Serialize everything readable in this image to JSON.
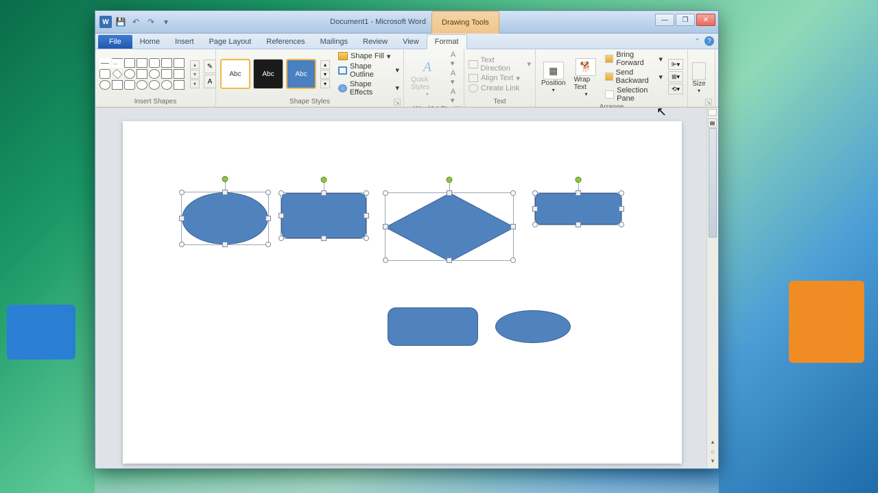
{
  "titlebar": {
    "doc_title": "Document1 - Microsoft Word",
    "contextual": "Drawing Tools",
    "qat": {
      "save": "💾",
      "undo": "↶",
      "redo": "↷",
      "more": "▾"
    }
  },
  "tabs": {
    "file": "File",
    "items": [
      "Home",
      "Insert",
      "Page Layout",
      "References",
      "Mailings",
      "Review",
      "View",
      "Format"
    ],
    "active": "Format"
  },
  "ribbon": {
    "insert_shapes": {
      "label": "Insert Shapes"
    },
    "shape_styles": {
      "label": "Shape Styles",
      "previews": [
        "Abc",
        "Abc",
        "Abc"
      ],
      "fill": "Shape Fill",
      "outline": "Shape Outline",
      "effects": "Shape Effects"
    },
    "wordart": {
      "label": "WordArt St…",
      "quick": "Quick Styles",
      "fill_a": "A",
      "fill_small": "A ▾",
      "outline_small": "A ▾",
      "effects_small": "A ▾"
    },
    "text": {
      "label": "Text",
      "direction": "Text Direction",
      "align": "Align Text",
      "link": "Create Link"
    },
    "arrange": {
      "label": "Arrange",
      "position": "Position",
      "wrap": "Wrap Text",
      "forward": "Bring Forward",
      "backward": "Send Backward",
      "selection": "Selection Pane"
    },
    "size": {
      "label": "Size"
    }
  },
  "canvas": {
    "shapes_selected": [
      "ellipse",
      "rounded-rect",
      "diamond",
      "rounded-rect"
    ],
    "shapes_unselected": [
      "rounded-rect",
      "ellipse"
    ]
  }
}
